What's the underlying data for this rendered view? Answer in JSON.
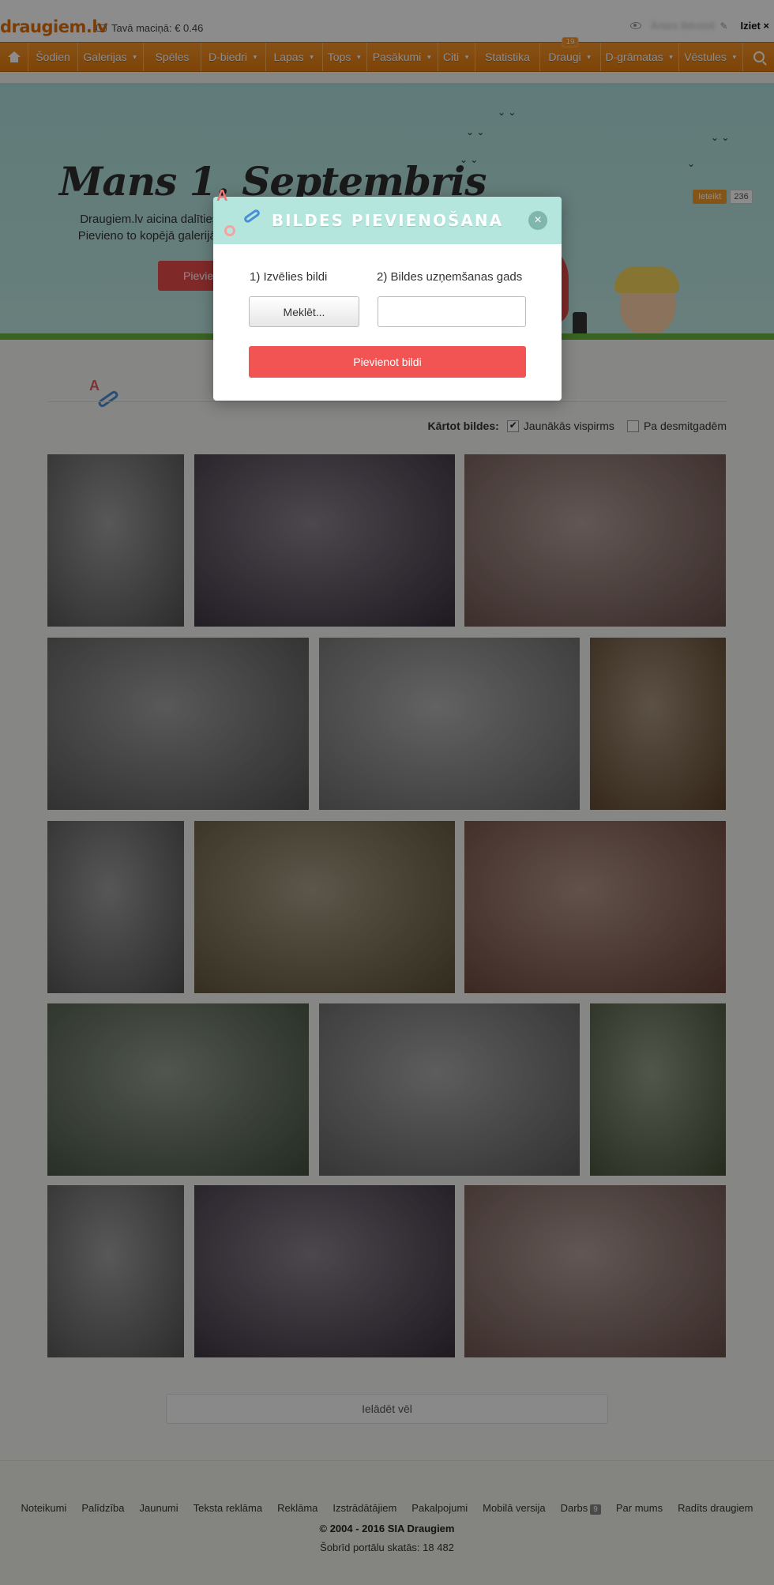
{
  "header": {
    "logo": "draugiem.lv",
    "wallet_text": "Tavā maciņā: € 0.46",
    "username": "Ārtūrs Bērziņš",
    "logout": "Iziet ×"
  },
  "nav": {
    "items": [
      {
        "label": "Šodien",
        "dropdown": false
      },
      {
        "label": "Galerijas",
        "dropdown": true
      },
      {
        "label": "Spēles",
        "dropdown": false
      },
      {
        "label": "D-biedri",
        "dropdown": true
      },
      {
        "label": "Lapas",
        "dropdown": true
      },
      {
        "label": "Tops",
        "dropdown": true
      },
      {
        "label": "Pasākumi",
        "dropdown": true
      },
      {
        "label": "Citi",
        "dropdown": true
      },
      {
        "label": "Statistika",
        "dropdown": false
      },
      {
        "label": "Draugi",
        "dropdown": true,
        "badge": "19"
      },
      {
        "label": "D-grāmatas",
        "dropdown": true
      },
      {
        "label": "Vēstules",
        "dropdown": true
      }
    ]
  },
  "hero": {
    "title": "Mans 1. Septembris",
    "text_line1": "Draugiem.lv aicina dalīties a",
    "text_line2": "Pievieno to kopējā galerijā ur",
    "button": "Pievien",
    "share_label": "Ieteikt",
    "share_count": "236",
    "paper_text": "A+"
  },
  "sort": {
    "label": "Kārtot bildes:",
    "options": [
      {
        "label": "Jaunākās vispirms",
        "checked": true
      },
      {
        "label": "Pa desmitgadēm",
        "checked": false
      }
    ]
  },
  "photos": [
    {
      "alt": "Meitene skolas formā ar ziediem (melnbalta)",
      "color": "#6e6e6e"
    },
    {
      "alt": "Pāris zilos džemperos",
      "color": "#4a4050"
    },
    {
      "alt": "Divas meitenes selfijā",
      "color": "#8a6a62"
    },
    {
      "alt": "Bērni sēž rindā (melnbalta)",
      "color": "#707070"
    },
    {
      "alt": "Meitene pie skolas (melnbalta)",
      "color": "#8a8a8a"
    },
    {
      "alt": "Meitene ar baltu apkakli",
      "color": "#7a5a3a"
    },
    {
      "alt": "Zēni ar ziediem",
      "color": "#6a6a6a"
    },
    {
      "alt": "Skolotāja ar ziedu pušķi",
      "color": "#7a6a48"
    },
    {
      "alt": "Zēns klasē ar zīmējumu",
      "color": "#8a5a4a"
    },
    {
      "alt": "Meitenes skolas formās iet pa ceļu",
      "color": "#5a6a52"
    },
    {
      "alt": "Meitene ar ābeci (melnbalta)",
      "color": "#7c7c7c"
    },
    {
      "alt": "Bērni ar somām iet pa ceļu",
      "color": "#5a6a48"
    },
    {
      "alt": "Meitene skolas formā ar ziediem (melnbalta)",
      "color": "#6e6e6e"
    },
    {
      "alt": "Pāris zilos džemperos",
      "color": "#4a4050"
    },
    {
      "alt": "Divas meitenes selfijā",
      "color": "#8a6a62"
    }
  ],
  "load_more": "Ielādēt vēl",
  "footer": {
    "links": [
      {
        "label": "Noteikumi"
      },
      {
        "label": "Palīdzība"
      },
      {
        "label": "Jaunumi"
      },
      {
        "label": "Teksta reklāma"
      },
      {
        "label": "Reklāma"
      },
      {
        "label": "Izstrādātājiem"
      },
      {
        "label": "Pakalpojumi"
      },
      {
        "label": "Mobilā versija"
      },
      {
        "label": "Darbs",
        "badge": "9"
      },
      {
        "label": "Par mums"
      },
      {
        "label": "Radīts draugiem"
      }
    ],
    "copyright": "© 2004 - 2016 SIA Draugiem",
    "views": "Šobrīd portālu skatās: 18 482"
  },
  "modal": {
    "title": "BILDES PIEVIENOŠANA",
    "step1": "1) Izvēlies bildi",
    "step2": "2) Bildes uzņemšanas gads",
    "browse": "Meklēt...",
    "year_value": "",
    "submit": "Pievienot bildi",
    "close": "×"
  },
  "colors": {
    "nav_orange": "#f39224",
    "hero_teal": "#b4e6dd",
    "submit_red": "#f25454",
    "logo_orange": "#e06f0c"
  }
}
